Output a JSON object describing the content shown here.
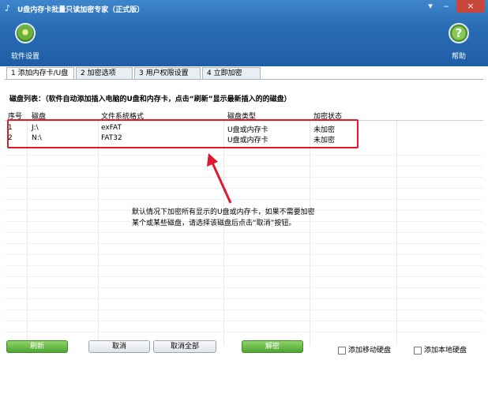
{
  "window": {
    "title": "U盘内存卡批量只读加密专家（正式版）",
    "minimize_glyph": "▾ ‒",
    "maximize_glyph": "",
    "close_glyph": "×"
  },
  "toolbar": {
    "settings_label": "软件设置",
    "settings_icon": "gear-icon",
    "help_label": "帮助",
    "help_icon": "help-icon",
    "help_glyph": "?"
  },
  "tabs": [
    {
      "label": "1 添加内存卡/U盘"
    },
    {
      "label": "2 加密选项"
    },
    {
      "label": "3 用户权限设置"
    },
    {
      "label": "4 立即加密"
    }
  ],
  "list": {
    "caption": "磁盘列表：（软件自动添加插入电脑的U盘和内存卡，点击“刷新”显示最新插入的的磁盘）",
    "columns": [
      "序号",
      "磁盘",
      "文件系统格式",
      "磁盘类型",
      "加密状态"
    ],
    "rows": [
      [
        "1",
        "J:\\",
        "exFAT",
        "U盘或内存卡",
        "未加密"
      ],
      [
        "2",
        "N:\\",
        "FAT32",
        "U盘或内存卡",
        "未加密"
      ]
    ]
  },
  "note": {
    "line1": "默认情况下加密所有显示的U盘或内存卡，如果不需要加密",
    "line2": "某个或某些磁盘，请选择该磁盘后点击“取消”按钮。"
  },
  "buttons": {
    "refresh": "刷新",
    "cancel": "取消",
    "cancel_all": "取消全部",
    "decrypt": "解密"
  },
  "checkboxes": {
    "add_removable": "添加移动硬盘",
    "add_local": "添加本地硬盘"
  },
  "colors": {
    "header": "#2a6db5",
    "highlight": "#e0182b",
    "green_button": "#4ea532"
  }
}
